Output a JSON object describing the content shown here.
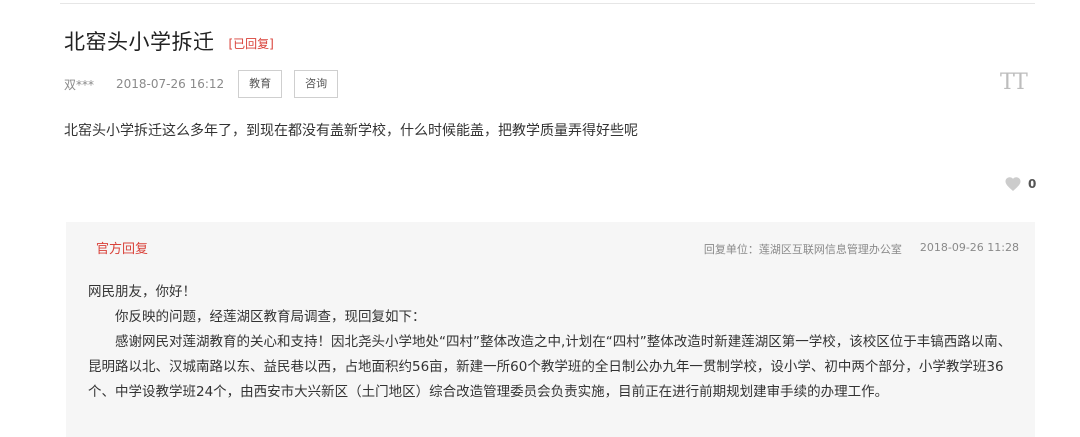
{
  "question": {
    "title": "北窑头小学拆迁",
    "status": "[已回复]",
    "author": "双***",
    "date": "2018-07-26 16:12",
    "tags": [
      "教育",
      "咨询"
    ],
    "font_toggle": "TT",
    "body": "北窑头小学拆迁这么多年了，到现在都没有盖新学校，什么时候能盖，把教学质量弄得好些呢",
    "like_count": "0"
  },
  "reply": {
    "label": "官方回复",
    "unit": "回复单位：莲湖区互联网信息管理办公室",
    "date": "2018-09-26 11:28",
    "greeting": "网民朋友，你好！",
    "para1": "你反映的问题，经莲湖区教育局调查，现回复如下：",
    "para2": "感谢网民对莲湖教育的关心和支持！因北尧头小学地处“四村”整体改造之中,计划在“四村”整体改造时新建莲湖区第一学校，该校区位于丰镐西路以南、昆明路以北、汉城南路以东、益民巷以西，占地面积约56亩，新建一所60个教学班的全日制公办九年一贯制学校，设小学、初中两个部分，小学教学班36个、中学设教学班24个，由西安市大兴新区（土门地区）综合改造管理委员会负责实施，目前正在进行前期规划建审手续的办理工作。"
  },
  "colors": {
    "accent_red": "#d9423a",
    "reply_bg": "#f6f6f6"
  }
}
